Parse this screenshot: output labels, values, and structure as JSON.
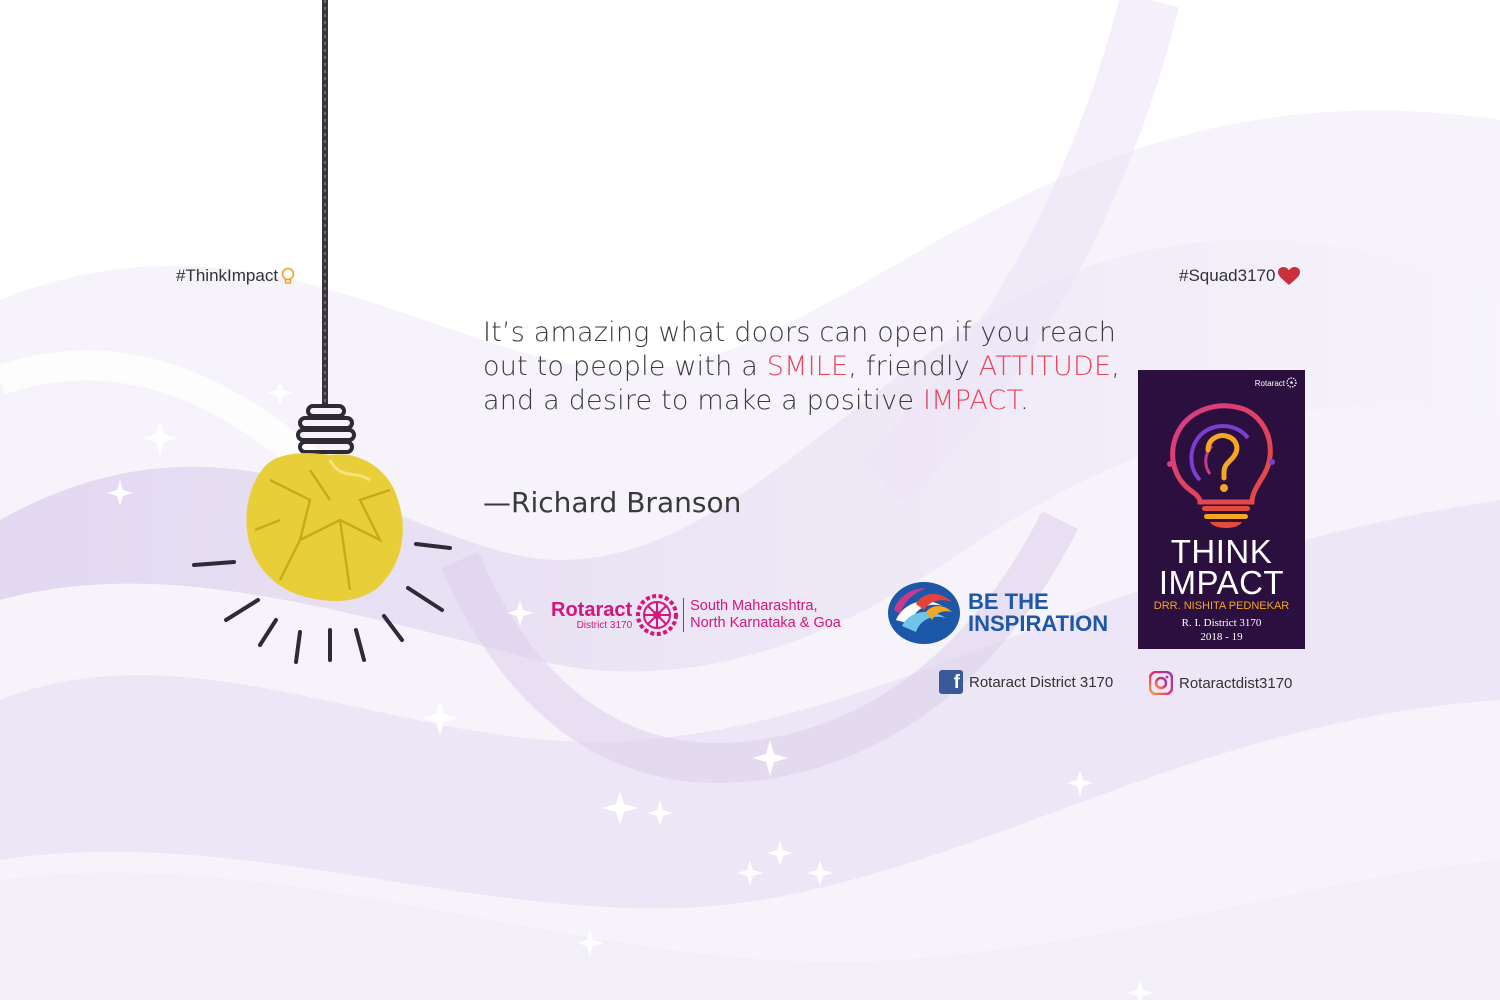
{
  "hashtags": {
    "left": "#ThinkImpact",
    "right": "#Squad3170"
  },
  "quote": {
    "part1": "It’s amazing what doors can open if you reach out to people with a ",
    "highlight1": "SMILE",
    "part2": ", friendly ",
    "highlight2": "ATTITUDE",
    "part3": ", and a desire to make a positive ",
    "highlight3": "IMPACT",
    "part4": ".",
    "author": "—Richard Branson"
  },
  "rotaract_logo": {
    "name": "Rotaract",
    "district": "District 3170",
    "region_line1": "South Maharashtra,",
    "region_line2": "North Karnataka & Goa"
  },
  "inspiration_logo": {
    "line1": "BE THE",
    "line2": "INSPIRATION"
  },
  "poster": {
    "brand": "Rotaract",
    "title_line1": "THINK",
    "title_line2": "IMPACT",
    "leader": "DRR. NISHITA PEDNEKAR",
    "district": "R. I. District 3170",
    "year": "2018 - 19"
  },
  "social": {
    "facebook": "Rotaract District 3170",
    "instagram": "Rotaractdist3170"
  },
  "colors": {
    "highlight": "#e8445a",
    "rotaract_pink": "#d4167c",
    "inspiration_blue": "#1d57a8",
    "poster_bg": "#2b0f3e"
  },
  "icons": {
    "bulb": "hanging-paper-lightbulb",
    "small_bulb": "lightbulb-icon",
    "heart": "heart-icon",
    "facebook": "facebook-icon",
    "instagram": "instagram-icon"
  }
}
